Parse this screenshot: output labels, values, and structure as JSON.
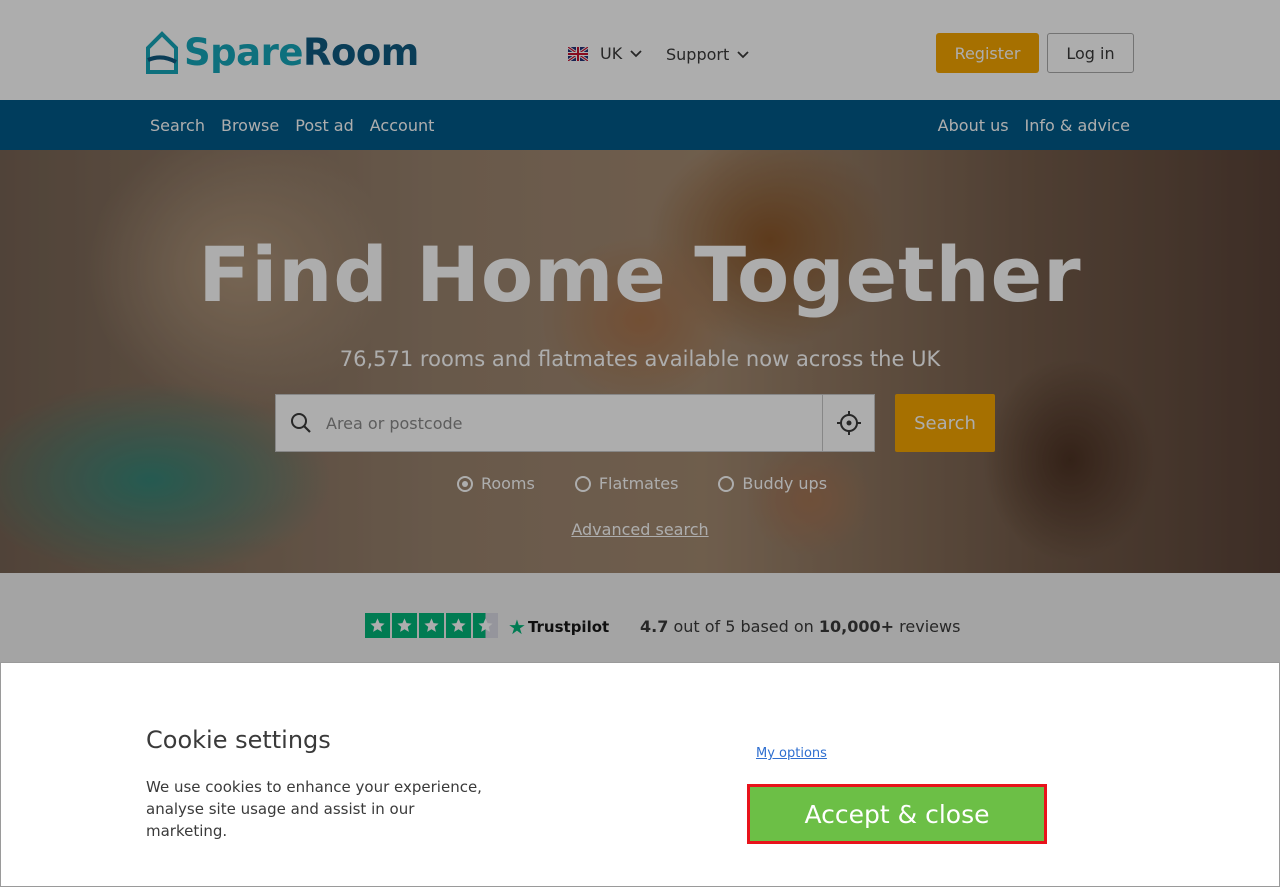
{
  "header": {
    "logo_text_a": "Spare",
    "logo_text_b": "Room",
    "language": "UK",
    "support_label": "Support",
    "register_label": "Register",
    "login_label": "Log in",
    "brand_teal": "#16a5b8",
    "brand_navy": "#0f5a80"
  },
  "nav": {
    "left": [
      "Search",
      "Browse",
      "Post ad",
      "Account"
    ],
    "right": [
      "About us",
      "Info & advice"
    ],
    "background": "#005b8a"
  },
  "hero": {
    "title": "Find Home Together",
    "subtitle": "76,571 rooms and flatmates available now across the UK",
    "search_placeholder": "Area or postcode",
    "search_button": "Search",
    "radios": [
      {
        "label": "Rooms",
        "selected": true
      },
      {
        "label": "Flatmates",
        "selected": false
      },
      {
        "label": "Buddy ups",
        "selected": false
      }
    ],
    "advanced_link": "Advanced search",
    "accent": "#f5a500"
  },
  "trustpilot": {
    "brand": "Trustpilot",
    "rating": "4.7",
    "rating_text": "out of 5 based on",
    "reviews_count": "10,000+",
    "reviews_label": "reviews",
    "stars": 4.5,
    "star_color": "#00b67a"
  },
  "cookie": {
    "title": "Cookie settings",
    "description": "We use cookies to enhance your experience, analyse site usage and assist in our marketing.",
    "options_link": "My options",
    "accept_label": "Accept & close",
    "accept_color": "#6cbf46",
    "highlight_color": "#e8131b"
  }
}
